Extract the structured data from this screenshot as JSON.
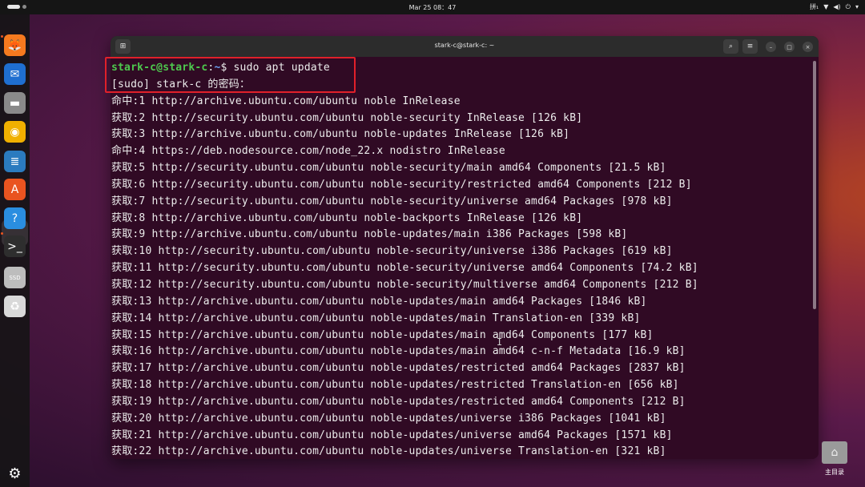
{
  "topbar": {
    "clock": "Mar 25  08：47",
    "input_method": "拼₁",
    "icons": [
      "network-icon",
      "volume-icon",
      "power-icon",
      "tray-menu-icon"
    ]
  },
  "dock": {
    "apps": [
      {
        "name": "firefox-icon",
        "glyph": "🦊",
        "bg": "#f57a1f"
      },
      {
        "name": "thunderbird-icon",
        "glyph": "✉",
        "bg": "#1f6fd0"
      },
      {
        "name": "files-icon",
        "glyph": "▬",
        "bg": "#8a8a8a"
      },
      {
        "name": "rhythmbox-icon",
        "glyph": "◉",
        "bg": "#f0b000"
      },
      {
        "name": "writer-icon",
        "glyph": "≣",
        "bg": "#2b7bbf"
      },
      {
        "name": "app-center-icon",
        "glyph": "A",
        "bg": "#e95420"
      },
      {
        "name": "help-icon",
        "glyph": "?",
        "bg": "#2a8ee0"
      },
      {
        "name": "terminal-icon",
        "glyph": ">_",
        "bg": "#2e2e2e"
      },
      {
        "name": "ssd-icon",
        "glyph": "SSD",
        "bg": "#bdbdbd"
      },
      {
        "name": "trash-icon",
        "glyph": "♻",
        "bg": "#d9d9d9"
      }
    ],
    "show_apps_icon": "ubuntu-logo-icon"
  },
  "window": {
    "title": "stark-c@stark-c: ~"
  },
  "terminal": {
    "prompt_user": "stark-c@stark-c",
    "prompt_sep": ":",
    "prompt_path": "~",
    "prompt_command": "$ sudo apt update",
    "lines": [
      "[sudo] stark-c 的密码：",
      "命中:1 http://archive.ubuntu.com/ubuntu noble InRelease",
      "获取:2 http://security.ubuntu.com/ubuntu noble-security InRelease [126 kB]",
      "获取:3 http://archive.ubuntu.com/ubuntu noble-updates InRelease [126 kB]",
      "命中:4 https://deb.nodesource.com/node_22.x nodistro InRelease",
      "获取:5 http://security.ubuntu.com/ubuntu noble-security/main amd64 Components [21.5 kB]",
      "获取:6 http://security.ubuntu.com/ubuntu noble-security/restricted amd64 Components [212 B]",
      "获取:7 http://security.ubuntu.com/ubuntu noble-security/universe amd64 Packages [978 kB]",
      "获取:8 http://archive.ubuntu.com/ubuntu noble-backports InRelease [126 kB]",
      "获取:9 http://archive.ubuntu.com/ubuntu noble-updates/main i386 Packages [598 kB]",
      "获取:10 http://security.ubuntu.com/ubuntu noble-security/universe i386 Packages [619 kB]",
      "获取:11 http://security.ubuntu.com/ubuntu noble-security/universe amd64 Components [74.2 kB]",
      "获取:12 http://security.ubuntu.com/ubuntu noble-security/multiverse amd64 Components [212 B]",
      "获取:13 http://archive.ubuntu.com/ubuntu noble-updates/main amd64 Packages [1846 kB]",
      "获取:14 http://archive.ubuntu.com/ubuntu noble-updates/main Translation-en [339 kB]",
      "获取:15 http://archive.ubuntu.com/ubuntu noble-updates/main amd64 Components [177 kB]",
      "获取:16 http://archive.ubuntu.com/ubuntu noble-updates/main amd64 c-n-f Metadata [16.9 kB]",
      "获取:17 http://archive.ubuntu.com/ubuntu noble-updates/restricted amd64 Packages [2837 kB]",
      "获取:18 http://archive.ubuntu.com/ubuntu noble-updates/restricted Translation-en [656 kB]",
      "获取:19 http://archive.ubuntu.com/ubuntu noble-updates/restricted amd64 Components [212 B]",
      "获取:20 http://archive.ubuntu.com/ubuntu noble-updates/universe i386 Packages [1041 kB]",
      "获取:21 http://archive.ubuntu.com/ubuntu noble-updates/universe amd64 Packages [1571 kB]",
      "获取:22 http://archive.ubuntu.com/ubuntu noble-updates/universe Translation-en [321 kB]"
    ]
  },
  "desktop": {
    "home_label": "主目录"
  },
  "colors": {
    "terminal_bg": "#300a24",
    "prompt_user": "#4ec94e",
    "prompt_path": "#6aa0f0",
    "highlight_box": "#e0202a"
  }
}
